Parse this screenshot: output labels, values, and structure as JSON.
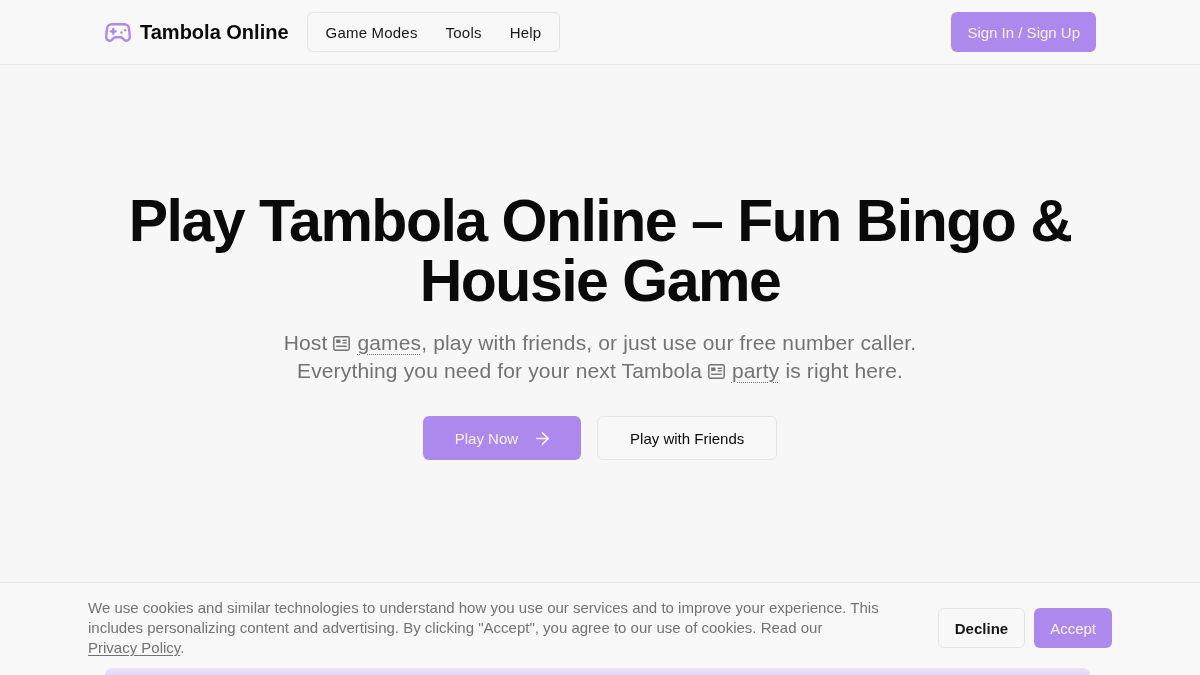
{
  "header": {
    "brand": "Tambola Online",
    "nav": [
      {
        "label": "Game Modes"
      },
      {
        "label": "Tools"
      },
      {
        "label": "Help"
      }
    ],
    "auth_button": "Sign In / Sign Up"
  },
  "hero": {
    "title": "Play Tambola Online – Fun Bingo & Housie Game",
    "subtitle_lines": [
      [
        {
          "kind": "text",
          "text": "Host "
        },
        {
          "kind": "term",
          "text": "games"
        },
        {
          "kind": "text",
          "text": ", play with friends, or just use our free number caller."
        }
      ],
      [
        {
          "kind": "text",
          "text": "Everything you need for your next Tambola "
        },
        {
          "kind": "term",
          "text": "party"
        },
        {
          "kind": "text",
          "text": " is right here."
        }
      ]
    ],
    "buttons": [
      {
        "label": "Play Now",
        "kind": "primary",
        "arrow": true
      },
      {
        "label": "Play with Friends",
        "kind": "secondary",
        "arrow": false
      }
    ]
  },
  "cookie_banner": {
    "message": [
      {
        "kind": "text",
        "text": "We use cookies and similar technologies to understand how you use our services and to improve your experience. This includes personalizing content and advertising. By clicking \"Accept\", you agree to our use of cookies. Read our "
      },
      {
        "kind": "link",
        "text": "Privacy Policy"
      },
      {
        "kind": "text",
        "text": "."
      }
    ],
    "buttons": [
      {
        "label": "Decline",
        "kind": "secondary"
      },
      {
        "label": "Accept",
        "kind": "primary"
      }
    ]
  }
}
